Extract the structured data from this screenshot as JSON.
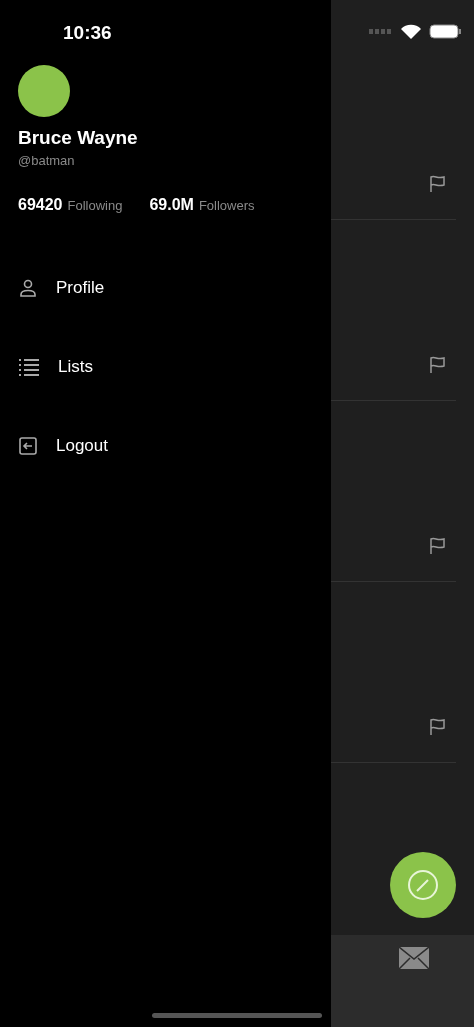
{
  "status_bar": {
    "time": "10:36"
  },
  "drawer": {
    "name": "Bruce Wayne",
    "handle": "@batman",
    "stats": [
      {
        "value": "69420",
        "label": "Following"
      },
      {
        "value": "69.0M",
        "label": "Followers"
      }
    ],
    "menu": [
      {
        "label": "Profile",
        "kind": "profile"
      },
      {
        "label": "Lists",
        "kind": "lists"
      },
      {
        "label": "Logout",
        "kind": "logout"
      }
    ]
  },
  "feed": [
    {
      "kind": "post"
    },
    {
      "kind": "post"
    },
    {
      "kind": "post"
    },
    {
      "kind": "post"
    }
  ],
  "tab_bar": [
    {
      "kind": "messages"
    }
  ]
}
